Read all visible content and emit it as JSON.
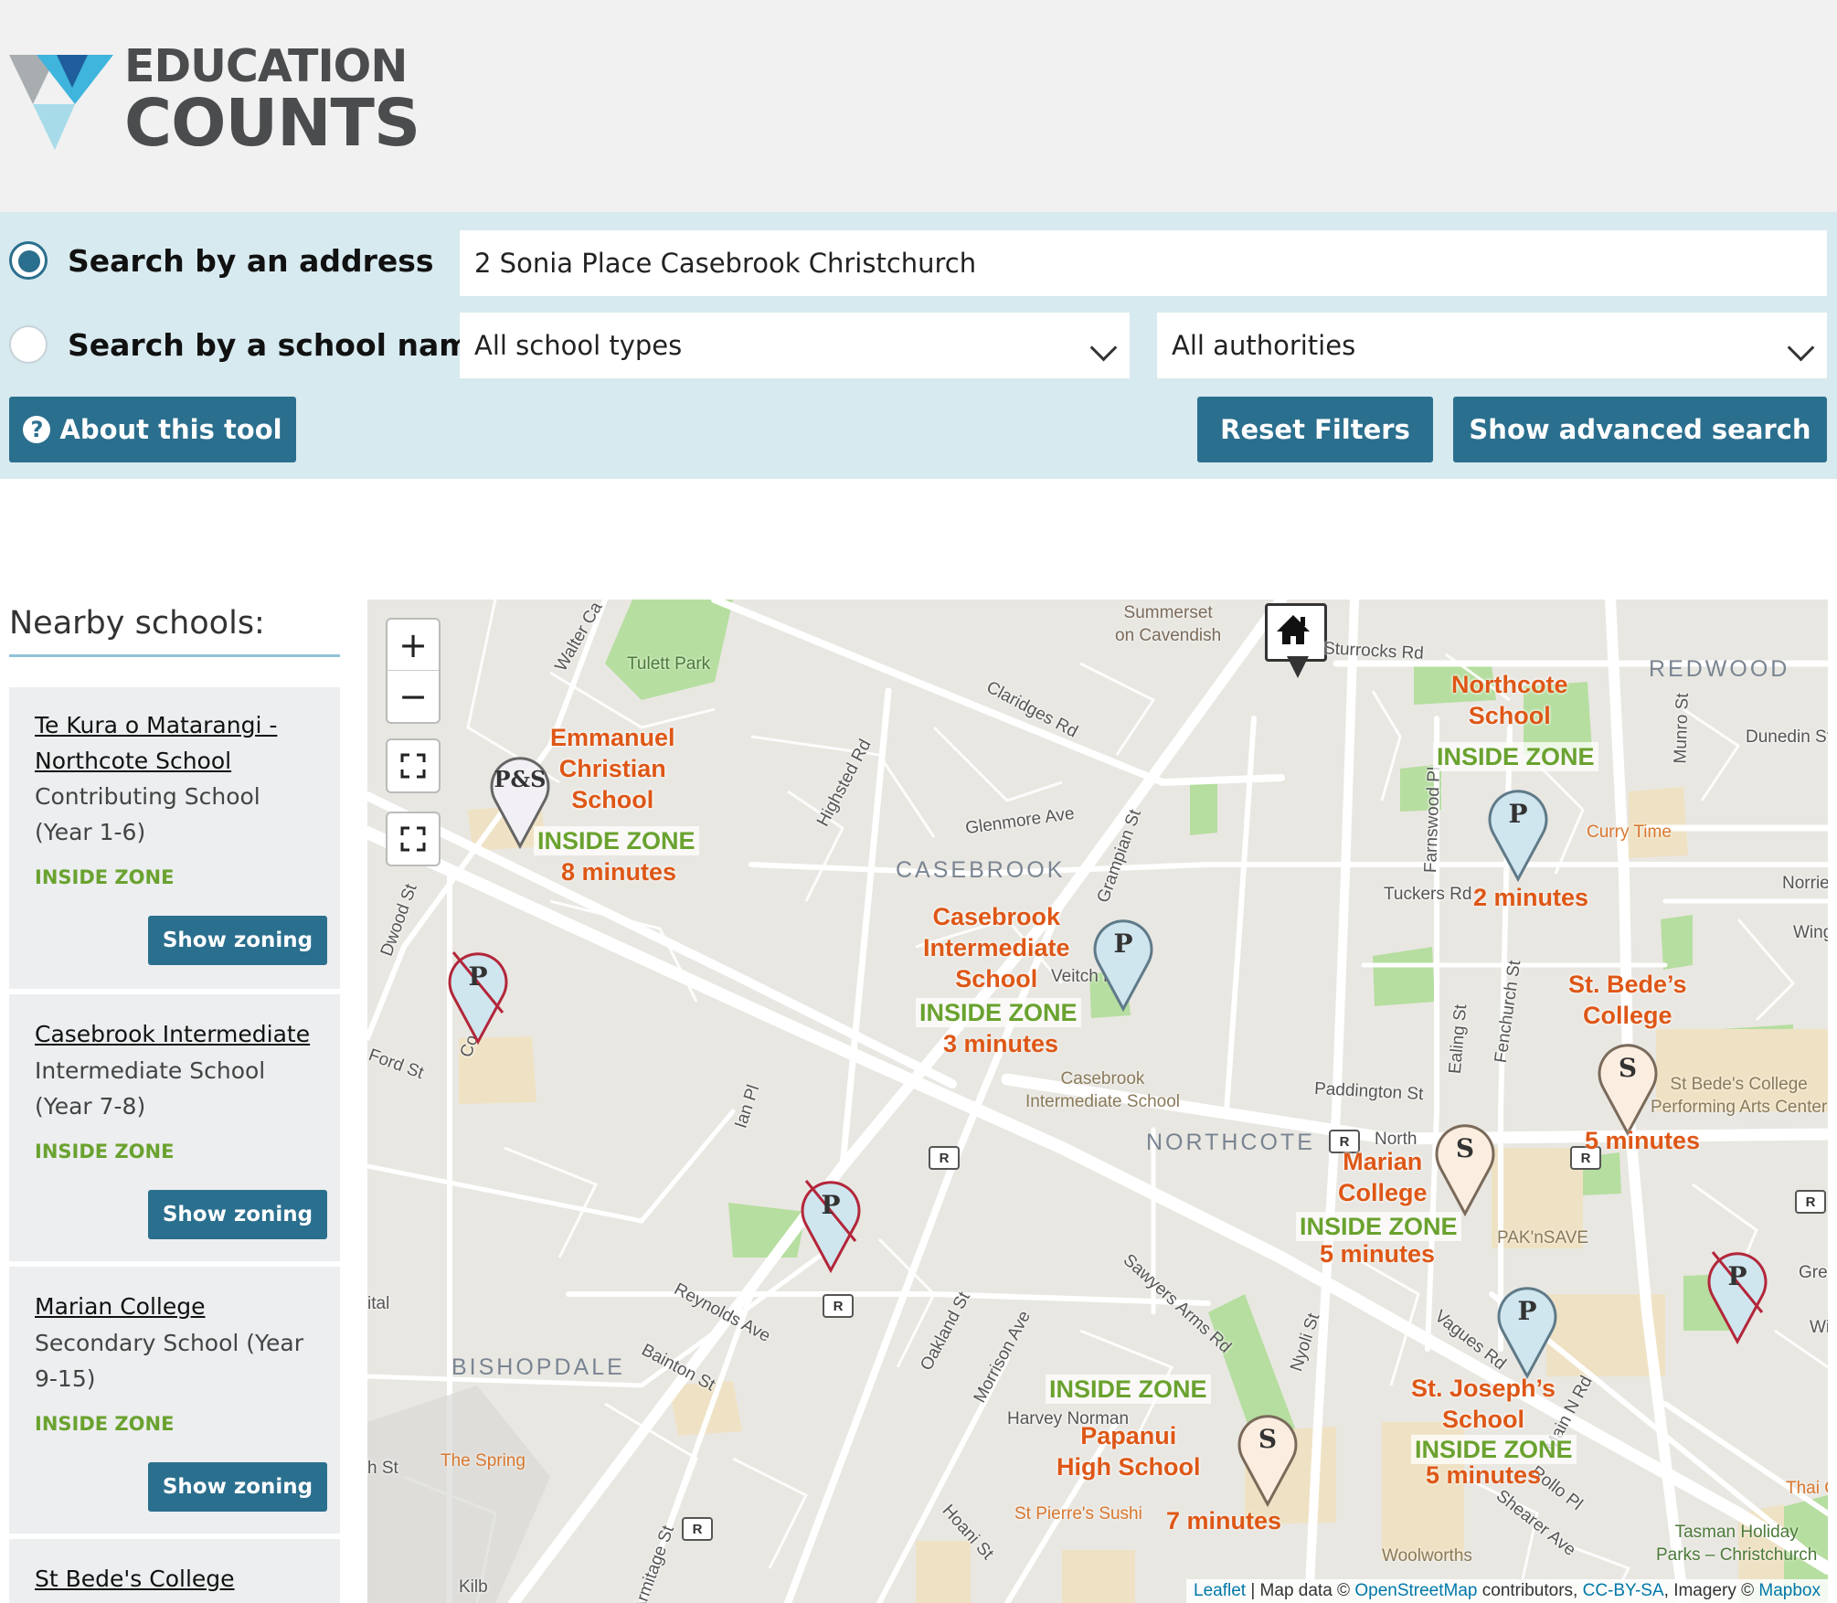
{
  "header": {
    "logo_line1": "EDUCATION",
    "logo_line2": "COUNTS"
  },
  "search": {
    "by_address_label": "Search by an address",
    "by_school_label": "Search by a school name",
    "address_value": "2 Sonia Place Casebrook Christchurch",
    "school_types_value": "All school types",
    "authorities_value": "All authorities",
    "about_label": "About this tool",
    "reset_label": "Reset Filters",
    "advanced_label": "Show advanced search"
  },
  "sidebar": {
    "title": "Nearby schools:",
    "schools": [
      {
        "name": "Te Kura o Matarangi - Northcote School",
        "type": "Contributing School (Year 1-6)",
        "zone": "INSIDE ZONE",
        "button": "Show zoning"
      },
      {
        "name": "Casebrook Intermediate",
        "type": "Intermediate School (Year 7-8)",
        "zone": "INSIDE ZONE",
        "button": "Show zoning"
      },
      {
        "name": "Marian College",
        "type": "Secondary School (Year 9-15)",
        "zone": "INSIDE ZONE",
        "button": "Show zoning"
      },
      {
        "name": "St Bede's College"
      }
    ]
  },
  "map": {
    "zoom_in": "+",
    "zoom_out": "−",
    "markers": [
      {
        "letter": "P&S",
        "label": "Emmanuel\nChristian\nSchool",
        "zone": "INSIDE ZONE",
        "time": "8 minutes"
      },
      {
        "letter": "P",
        "label": "Northcote\nSchool",
        "zone": "INSIDE ZONE",
        "time": "2 minutes"
      },
      {
        "letter": "P",
        "label": "Casebrook\nIntermediate\nSchool",
        "zone": "INSIDE ZONE",
        "time": "3 minutes"
      },
      {
        "letter": "S",
        "label": "St. Bede’s\nCollege",
        "time": "5 minutes"
      },
      {
        "letter": "S",
        "label": "Marian\nCollege",
        "zone": "INSIDE ZONE",
        "time": "5 minutes"
      },
      {
        "letter": "P",
        "label": "St. Joseph’s\nSchool",
        "zone": "INSIDE ZONE",
        "time": "5 minutes"
      },
      {
        "letter": "S",
        "label": "Papanui\nHigh School",
        "zone": "INSIDE ZONE",
        "time": "7 minutes"
      },
      {
        "letter": "P"
      },
      {
        "letter": "P"
      },
      {
        "letter": "P"
      }
    ],
    "suburbs": [
      "CASEBROOK",
      "NORTHCOTE",
      "BISHOPDALE",
      "REDWOOD"
    ],
    "streets": [
      "Claridges Rd",
      "Highsted Rd",
      "Glenmore Ave",
      "Grampian St",
      "Veitch Rd",
      "Farnswood Pl",
      "Tuckers Rd",
      "Munro St",
      "Dunedin St",
      "Norrie",
      "Winga",
      "Paddington St",
      "Ealing St",
      "Fenchurch St",
      "North",
      "Sawyers Arms Rd",
      "Reynolds Ave",
      "Bainton St",
      "Oakland St",
      "Morrison Ave",
      "Nyoli St",
      "Vagues Rd",
      "Main N Rd",
      "Shearer Ave",
      "Hoani St",
      "Armitage St",
      "Ian Pl",
      "Walter Ca",
      "Sturrocks Rd",
      "Harvey Norman",
      "Greeno",
      "Wi",
      "Rollo Pl",
      "Dwood St",
      "Ford St",
      "Co",
      "Kilb",
      "h St",
      "ital"
    ],
    "pois": [
      "Tulett Park",
      "Summerset\non Cavendish",
      "Curry Time",
      "Casebrook\nIntermediate School",
      "St Bede's College\nPerforming Arts Center",
      "PAK'nSAVE",
      "The Spring",
      "St Pierre's Sushi",
      "Woolworths",
      "Thai Ga",
      "Tasman Holiday\nParks – Christchurch"
    ],
    "attribution": {
      "leaflet": "Leaflet",
      "map_data": " | Map data © ",
      "osm": "OpenStreetMap",
      "contrib": " contributors, ",
      "license": "CC-BY-SA",
      "imagery": ", Imagery © ",
      "mapbox": "Mapbox"
    }
  }
}
